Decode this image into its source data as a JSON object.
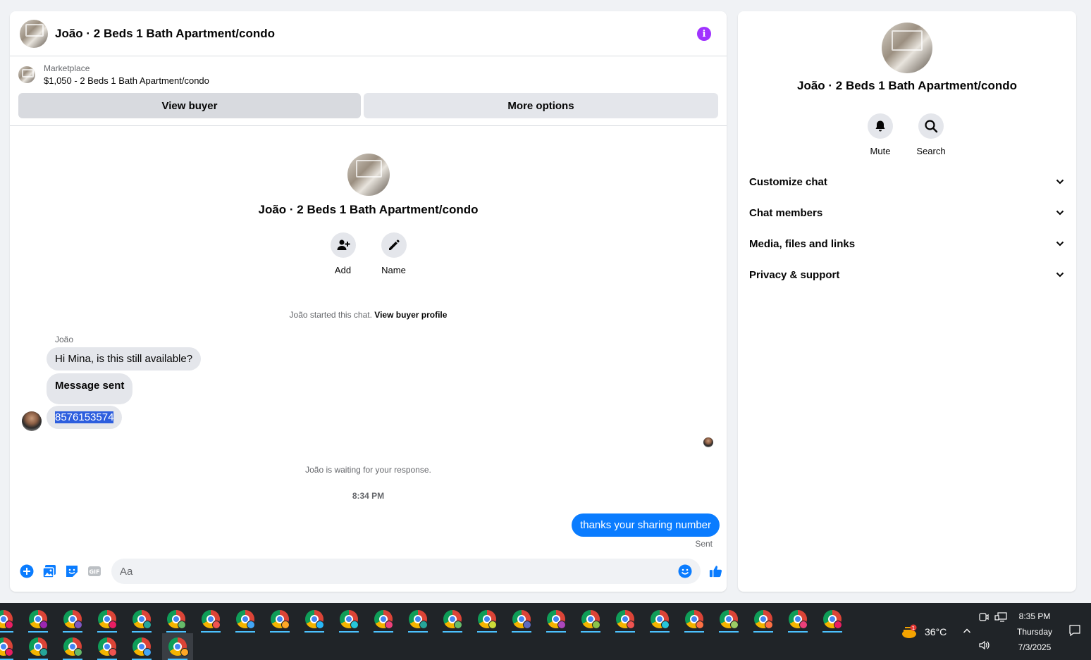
{
  "chat": {
    "title": "João · 2 Beds 1 Bath Apartment/condo",
    "listing": {
      "label": "Marketplace",
      "description": "$1,050 - 2 Beds 1 Bath Apartment/condo"
    },
    "buttons": {
      "view_buyer": "View buyer",
      "more_options": "More options"
    },
    "intro": {
      "name": "João · 2 Beds 1 Bath Apartment/condo",
      "add_label": "Add",
      "name_label": "Name"
    },
    "started_text": "João started this chat.",
    "view_buyer_profile": "View buyer profile",
    "sender_name": "João",
    "messages_in": [
      "Hi Mina, is this still available?",
      "Message sent",
      "8576153574"
    ],
    "waiting_text": "João is waiting for your response.",
    "timestamp": "8:34 PM",
    "message_out": "thanks your sharing number",
    "sent_status": "Sent",
    "composer": {
      "placeholder": "Aa"
    },
    "accent_color": "#0a7cff"
  },
  "info_panel": {
    "name": "João · 2 Beds 1 Bath Apartment/condo",
    "mute_label": "Mute",
    "search_label": "Search",
    "sections": [
      "Customize chat",
      "Chat members",
      "Media, files and links",
      "Privacy & support"
    ]
  },
  "taskbar": {
    "weather_temp": "36°C",
    "weather_badge": "1",
    "time": "8:35 PM",
    "day": "Thursday",
    "date": "7/3/2025"
  }
}
